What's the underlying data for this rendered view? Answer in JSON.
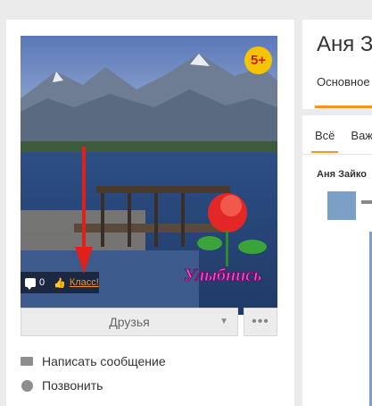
{
  "profile": {
    "name": "Аня З",
    "age_badge": "5+",
    "photo": {
      "comments_count": "0",
      "like_label": "Класс!",
      "sticker_text": "Улыбнись"
    },
    "friends_button": "Друзья",
    "more_button": "•••",
    "actions": [
      {
        "label": "Написать сообщение",
        "icon": "envelope-icon"
      },
      {
        "label": "Позвонить",
        "icon": "phone-icon"
      }
    ]
  },
  "right_panel": {
    "main_tab": "Основное",
    "feed_tabs": [
      "Всё",
      "Важ"
    ],
    "feed_author": "Аня Зайко"
  },
  "colors": {
    "accent": "#f7931e",
    "badge": "#f5c400",
    "arrow": "#e0201b"
  }
}
